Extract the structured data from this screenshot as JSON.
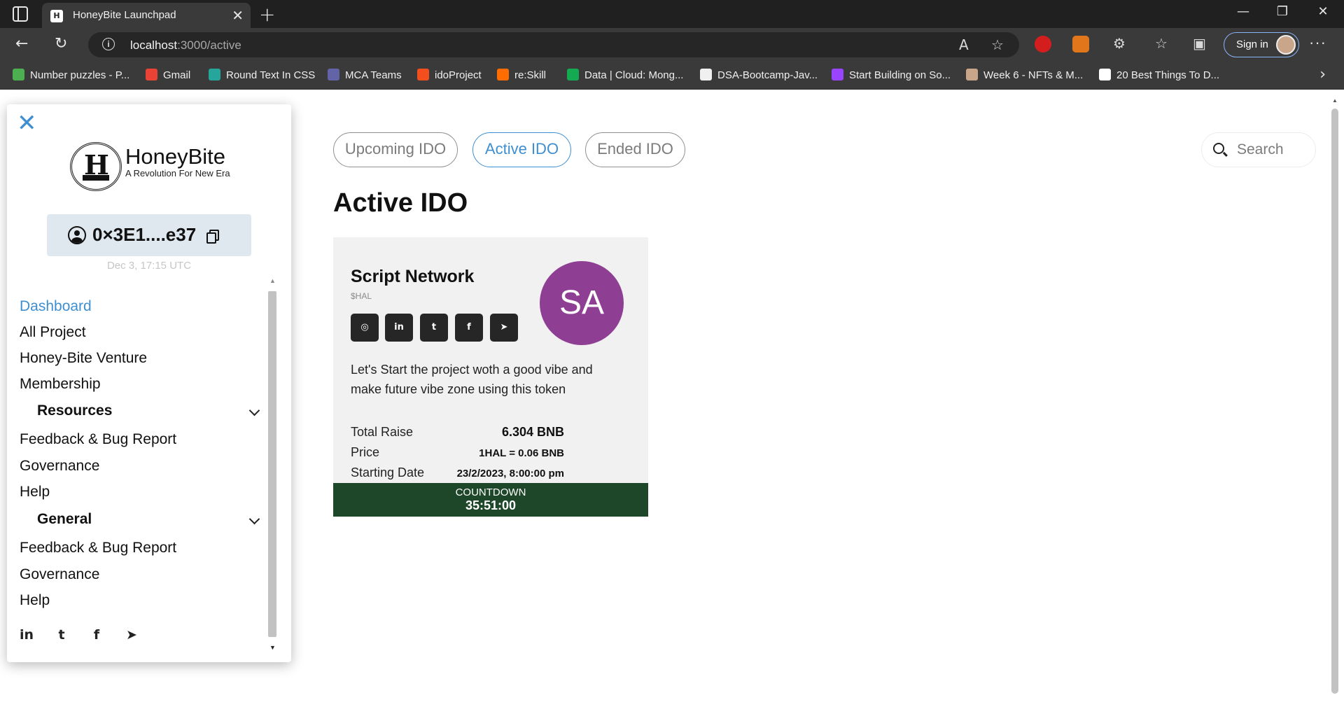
{
  "browser": {
    "tab_title": "HoneyBite Launchpad",
    "url_host": "localhost",
    "url_path": ":3000/active",
    "signin_label": "Sign in",
    "bookmarks": [
      {
        "label": "Number puzzles - P...",
        "color": "#4caf50"
      },
      {
        "label": "Gmail",
        "color": "#ea4335"
      },
      {
        "label": "Round Text In CSS",
        "color": "#26a69a"
      },
      {
        "label": "MCA Teams",
        "color": "#6264a7"
      },
      {
        "label": "idoProject",
        "color": "#f24e1e"
      },
      {
        "label": "re:Skill",
        "color": "#ff6d00"
      },
      {
        "label": "Data | Cloud: Mong...",
        "color": "#13aa52"
      },
      {
        "label": "DSA-Bootcamp-Jav...",
        "color": "#f0f0f0"
      },
      {
        "label": "Start Building on So...",
        "color": "#9945ff"
      },
      {
        "label": "Week 6 - NFTs & M...",
        "color": "#c9a58a"
      },
      {
        "label": "20 Best Things To D...",
        "color": "#ffffff"
      }
    ]
  },
  "sidebar": {
    "brand_name": "HoneyBite",
    "brand_tagline": "A Revolution For New Era",
    "wallet_address": "0×3E1....e37",
    "wallet_date": "Dec 3, 17:15 UTC",
    "menu": [
      {
        "label": "Dashboard",
        "active": true
      },
      {
        "label": "All Project"
      },
      {
        "label": "Honey-Bite Venture"
      },
      {
        "label": "Membership"
      }
    ],
    "resources_group": {
      "label": "Resources",
      "items": [
        "Feedback & Bug Report",
        "Governance",
        "Help"
      ]
    },
    "general_group": {
      "label": "General",
      "items": [
        "Feedback & Bug Report",
        "Governance",
        "Help"
      ]
    },
    "socials": [
      "linkedin-icon",
      "twitter-icon",
      "facebook-icon",
      "telegram-icon"
    ]
  },
  "main": {
    "tabs": [
      "Upcoming IDO",
      "Active IDO",
      "Ended IDO"
    ],
    "active_tab": "Active IDO",
    "search_placeholder": "Search",
    "page_title": "Active IDO",
    "card": {
      "name": "Script Network",
      "ticker": "$HAL",
      "avatar_initials": "SA",
      "avatar_color": "#8e3f93",
      "description": "Let's Start the project woth a good vibe and make future vibe zone using this token",
      "stats": [
        {
          "label": "Total Raise",
          "value": "6.304 BNB"
        },
        {
          "label": "Price",
          "value": "1HAL = 0.06 BNB"
        },
        {
          "label": "Starting Date",
          "value": "23/2/2023, 8:00:00 pm"
        }
      ],
      "countdown_label": "COUNTDOWN",
      "countdown_value": "35:51:00",
      "countdown_color": "#1d4728"
    }
  },
  "colors": {
    "accent": "#3f8fd0"
  }
}
